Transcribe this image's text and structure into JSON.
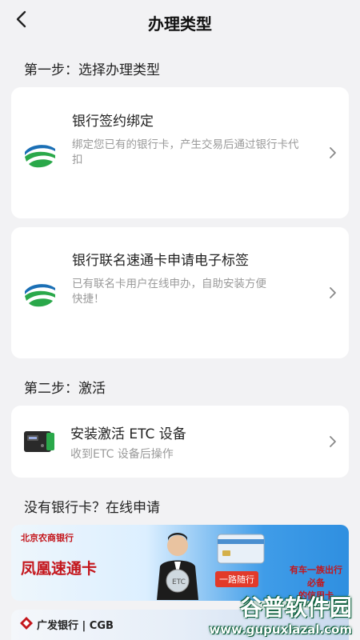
{
  "header": {
    "title": "办理类型"
  },
  "step1": {
    "title": "第一步：选择办理类型",
    "cards": [
      {
        "title": "银行签约绑定",
        "desc": "绑定您已有的银行卡，产生交易后通过银行卡代扣"
      },
      {
        "title": "银行联名速通卡申请电子标签",
        "desc": "已有联名卡用户在线申办，自助安装方便快捷！"
      }
    ]
  },
  "step2": {
    "title": "第二步：激活",
    "card": {
      "title": "安装激活 ETC 设备",
      "desc": "收到ETC 设备后操作"
    }
  },
  "apply": {
    "title": "没有银行卡？在线申请",
    "banner1": {
      "bank": "北京农商银行",
      "product": "凤凰速通卡",
      "slogan1": "有车一族出行必备",
      "slogan2": "的信用卡",
      "tag": "一路随行"
    },
    "banner2": {
      "bank": "广发银行 | CGB"
    }
  },
  "watermark": {
    "line1": "谷普软件园",
    "line2": "www.gupuxlazal.com"
  },
  "colors": {
    "accent_green": "#2aa84a",
    "accent_blue": "#1a6fb5",
    "banner_bg": "#2f8fe0"
  }
}
